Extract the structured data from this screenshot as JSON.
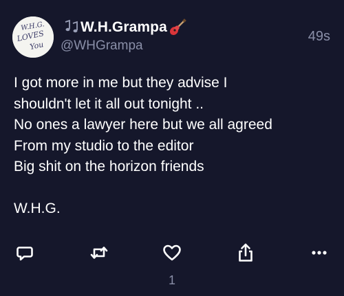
{
  "tweet": {
    "display_name": "W.H.Grampa",
    "name_emoji_left": "musical-notes-icon",
    "name_emoji_right": "guitar-icon",
    "handle": "@WHGrampa",
    "timestamp": "49s",
    "avatar_text": [
      "W.H.G.",
      "LOVES",
      "You"
    ],
    "body": "I got more in me but they advise I\nshouldn't let it all out tonight ..\nNo ones a lawyer here but we all agreed\nFrom my studio to the editor\nBig shit on the horizon friends\n\nW.H.G.",
    "like_count": "1"
  },
  "actions": [
    {
      "name": "reply",
      "icon": "reply-icon"
    },
    {
      "name": "retweet",
      "icon": "retweet-icon"
    },
    {
      "name": "like",
      "icon": "heart-icon"
    },
    {
      "name": "share",
      "icon": "share-icon"
    },
    {
      "name": "more",
      "icon": "more-icon"
    }
  ],
  "colors": {
    "background": "#15172b",
    "text": "#ffffff",
    "secondary_text": "#8a8fa8",
    "icon": "#ffffff"
  }
}
